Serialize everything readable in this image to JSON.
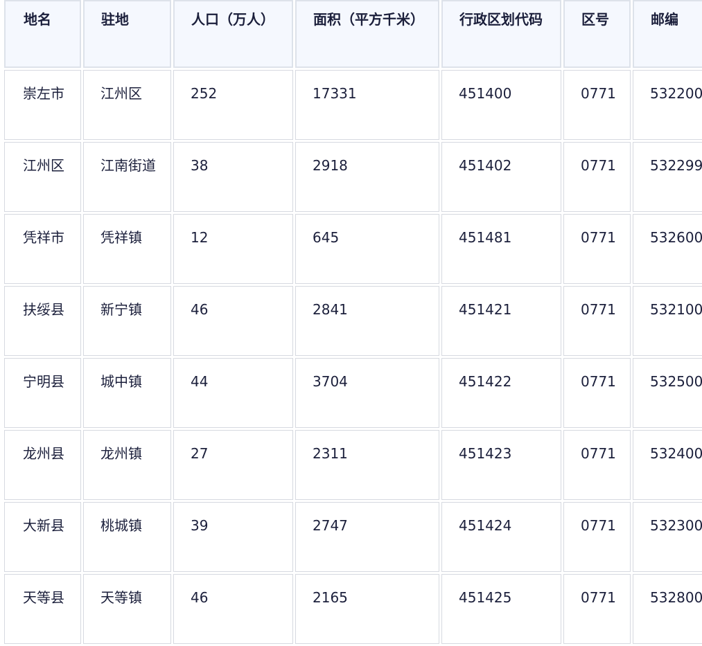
{
  "table": {
    "headers": [
      "地名",
      "驻地",
      "人口（万人）",
      "面积（平方千米）",
      "行政区划代码",
      "区号",
      "邮编"
    ],
    "rows": [
      [
        "崇左市",
        "江州区",
        "252",
        "17331",
        "451400",
        "0771",
        "532200"
      ],
      [
        "江州区",
        "江南街道",
        "38",
        "2918",
        "451402",
        "0771",
        "532299"
      ],
      [
        "凭祥市",
        "凭祥镇",
        "12",
        "645",
        "451481",
        "0771",
        "532600"
      ],
      [
        "扶绥县",
        "新宁镇",
        "46",
        "2841",
        "451421",
        "0771",
        "532100"
      ],
      [
        "宁明县",
        "城中镇",
        "44",
        "3704",
        "451422",
        "0771",
        "532500"
      ],
      [
        "龙州县",
        "龙州镇",
        "27",
        "2311",
        "451423",
        "0771",
        "532400"
      ],
      [
        "大新县",
        "桃城镇",
        "39",
        "2747",
        "451424",
        "0771",
        "532300"
      ],
      [
        "天等县",
        "天等镇",
        "46",
        "2165",
        "451425",
        "0771",
        "532800"
      ]
    ]
  }
}
